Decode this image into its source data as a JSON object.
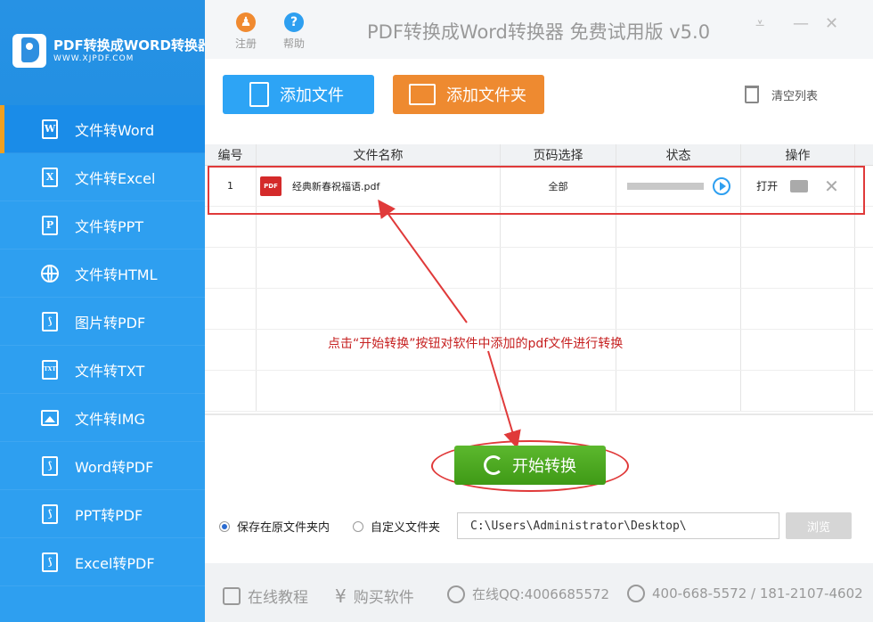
{
  "app": {
    "logo_title": "PDF转换成WORD转换器",
    "logo_url": "WWW.XJPDF.COM",
    "title": "PDF转换成Word转换器 免费试用版 v5.0",
    "register_label": "注册",
    "help_label": "帮助"
  },
  "sidebar": {
    "items": [
      {
        "label": "文件转Word",
        "icon": "W"
      },
      {
        "label": "文件转Excel",
        "icon": "X"
      },
      {
        "label": "文件转PPT",
        "icon": "P"
      },
      {
        "label": "文件转HTML",
        "icon": "globe"
      },
      {
        "label": "图片转PDF",
        "icon": "pdf"
      },
      {
        "label": "文件转TXT",
        "icon": "TXT"
      },
      {
        "label": "文件转IMG",
        "icon": "image"
      },
      {
        "label": "Word转PDF",
        "icon": "pdf"
      },
      {
        "label": "PPT转PDF",
        "icon": "pdf"
      },
      {
        "label": "Excel转PDF",
        "icon": "pdf"
      }
    ]
  },
  "toolbar": {
    "add_file": "添加文件",
    "add_folder": "添加文件夹",
    "clear_list": "清空列表"
  },
  "table": {
    "headers": [
      "编号",
      "文件名称",
      "页码选择",
      "状态",
      "操作"
    ],
    "rows": [
      {
        "index": "1",
        "badge": "PDF",
        "filename": "经典新春祝福语.pdf",
        "pages": "全部",
        "action_open": "打开"
      }
    ]
  },
  "annotation": "点击“开始转换”按钮对软件中添加的pdf文件进行转换",
  "start_button": "开始转换",
  "save": {
    "option_original": "保存在原文件夹内",
    "option_custom": "自定义文件夹",
    "path": "C:\\Users\\Administrator\\Desktop\\",
    "browse": "浏览"
  },
  "footer": {
    "tutorial": "在线教程",
    "buy": "购买软件",
    "qq": "在线QQ:4006685572",
    "phone": "400-668-5572 / 181-2107-4602"
  },
  "colors": {
    "sidebar": "#2e9ff0",
    "add_file_btn": "#2da4f5",
    "add_folder_btn": "#ee8a30",
    "start_btn": "#4aa81f",
    "annotation": "#e03a3a"
  }
}
